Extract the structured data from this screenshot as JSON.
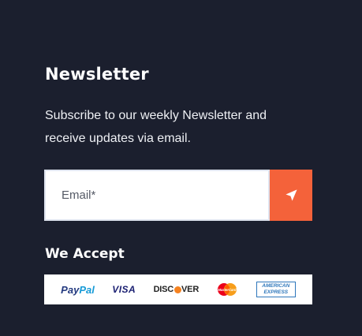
{
  "newsletter": {
    "title": "Newsletter",
    "description": "Subscribe to our weekly Newsletter and receive updates via email.",
    "email_placeholder": "Email*",
    "submit_icon": "paper-plane-icon",
    "accent_color": "#f4623a"
  },
  "payments": {
    "title": "We Accept",
    "cards": [
      {
        "name": "PayPal",
        "part1": "Pay",
        "part2": "Pal"
      },
      {
        "name": "VISA"
      },
      {
        "name": "DISCOVER",
        "part1": "DISC",
        "part2": "VER"
      },
      {
        "name": "MasterCard"
      },
      {
        "name": "AMERICAN EXPRESS",
        "line1": "AMERICAN",
        "line2": "EXPRESS"
      }
    ]
  }
}
